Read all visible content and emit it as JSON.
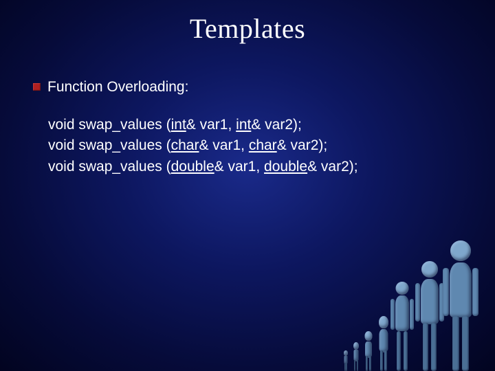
{
  "title": "Templates",
  "heading": "Function Overloading:",
  "code": {
    "l1": {
      "pre": "void swap_values (",
      "t1": "int",
      "m1": "& var1, ",
      "t2": "int",
      "post": "& var2);"
    },
    "l2": {
      "pre": "void swap_values (",
      "t1": "char",
      "m1": "& var1, ",
      "t2": "char",
      "post": "& var2);"
    },
    "l3": {
      "pre": "void swap_values (",
      "t1": "double",
      "m1": "& var1, ",
      "t2": "double",
      "post": "& var2);"
    }
  }
}
